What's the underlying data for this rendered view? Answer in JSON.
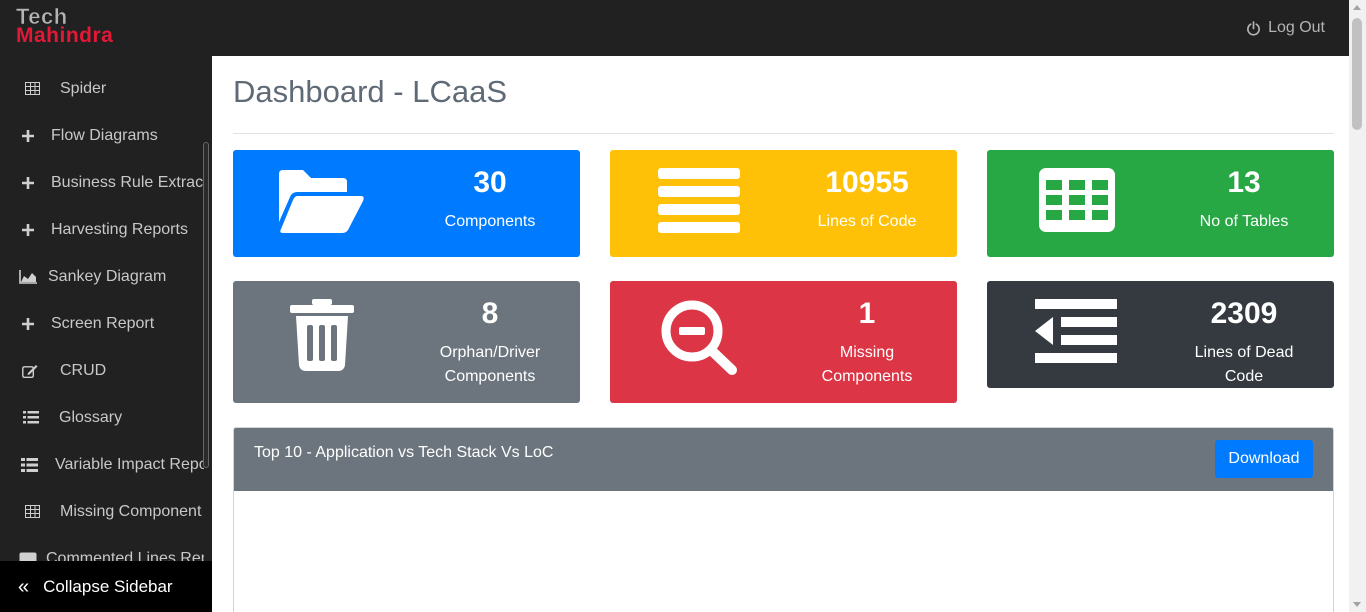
{
  "brand": {
    "line1": "Tech",
    "line2": "Mahindra"
  },
  "header": {
    "logout_label": "Log Out",
    "logout_icon": "power-icon"
  },
  "sidebar": {
    "items": [
      {
        "label": "Spider",
        "icon": "table-icon"
      },
      {
        "label": "Flow Diagrams",
        "icon": "plus-icon"
      },
      {
        "label": "Business Rule Extraction",
        "icon": "plus-icon"
      },
      {
        "label": "Harvesting Reports",
        "icon": "plus-icon"
      },
      {
        "label": "Sankey Diagram",
        "icon": "area-chart-icon"
      },
      {
        "label": "Screen Report",
        "icon": "plus-icon"
      },
      {
        "label": "CRUD",
        "icon": "edit-icon"
      },
      {
        "label": "Glossary",
        "icon": "list-icon"
      },
      {
        "label": "Variable Impact Report",
        "icon": "list-icon"
      },
      {
        "label": "Missing Component",
        "icon": "table-icon"
      },
      {
        "label": "Commented Lines Report",
        "icon": "comment-icon"
      }
    ],
    "collapse_label": "Collapse Sidebar",
    "collapse_icon": "double-chevron-left-icon"
  },
  "page": {
    "title": "Dashboard - LCaaS"
  },
  "cards": [
    {
      "value": "30",
      "label": "Components",
      "color": "#007bff",
      "icon": "folder-open-icon"
    },
    {
      "value": "10955",
      "label": "Lines of Code",
      "color": "#ffc107",
      "icon": "align-justify-icon"
    },
    {
      "value": "13",
      "label": "No of Tables",
      "color": "#28a745",
      "icon": "table-icon"
    },
    {
      "value": "8",
      "label": "Orphan/Driver Components",
      "color": "#6c757d",
      "icon": "trash-icon"
    },
    {
      "value": "1",
      "label": "Missing Components",
      "color": "#dc3545",
      "icon": "search-minus-icon"
    },
    {
      "value": "2309",
      "label": "Lines of Dead Code",
      "color": "#343a40",
      "icon": "outdent-icon"
    }
  ],
  "panel": {
    "title": "Top 10 - Application vs Tech Stack Vs LoC",
    "download_label": "Download"
  }
}
